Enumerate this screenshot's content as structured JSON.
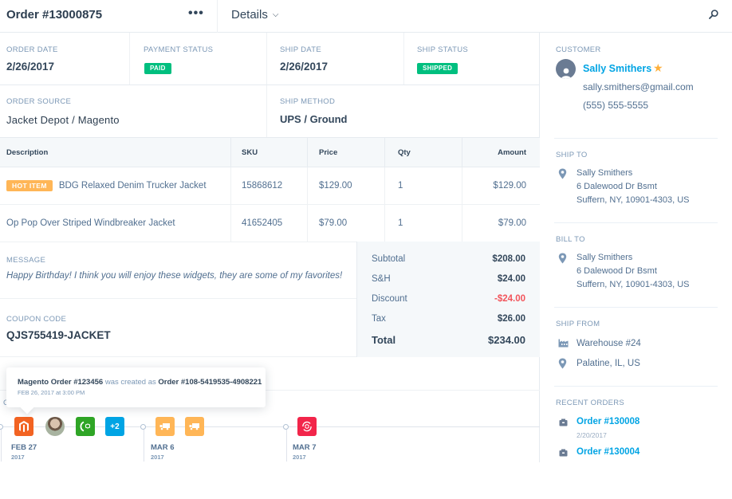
{
  "header": {
    "title": "Order #13000875",
    "more_icon": "more-horizontal-icon",
    "details_label": "Details",
    "search_icon": "search-icon"
  },
  "order_info": {
    "order_date": {
      "label": "ORDER DATE",
      "value": "2/26/2017"
    },
    "payment_status": {
      "label": "PAYMENT STATUS",
      "badge": "PAID",
      "color": "#00bf7f"
    },
    "ship_date": {
      "label": "SHIP DATE",
      "value": "2/26/2017"
    },
    "ship_status": {
      "label": "SHIP STATUS",
      "badge": "SHIPPED",
      "color": "#00bf7f"
    },
    "order_source": {
      "label": "ORDER SOURCE",
      "value": "Jacket Depot / Magento"
    },
    "ship_method": {
      "label": "SHIP METHOD",
      "value": "UPS / Ground"
    }
  },
  "line_items": {
    "columns": [
      "Description",
      "SKU",
      "Price",
      "Qty",
      "Amount"
    ],
    "rows": [
      {
        "tag": "HOT ITEM",
        "description": "BDG Relaxed Denim Trucker Jacket",
        "sku": "15868612",
        "price": "$129.00",
        "qty": "1",
        "amount": "$129.00"
      },
      {
        "tag": null,
        "description": "Op Pop Over Striped Windbreaker Jacket",
        "sku": "41652405",
        "price": "$79.00",
        "qty": "1",
        "amount": "$79.00"
      }
    ]
  },
  "message": {
    "label": "MESSAGE",
    "text": "Happy Birthday! I think you will enjoy these widgets, they are some of my favorites!"
  },
  "coupon": {
    "label": "COUPON CODE",
    "value": "QJS755419-JACKET"
  },
  "totals": {
    "subtotal": {
      "label": "Subtotal",
      "value": "$208.00"
    },
    "shipping": {
      "label": "S&H",
      "value": "$24.00"
    },
    "discount": {
      "label": "Discount",
      "value": "-$24.00",
      "color": "#f2545b"
    },
    "tax": {
      "label": "Tax",
      "value": "$26.00"
    },
    "total": {
      "label": "Total",
      "value": "$234.00"
    }
  },
  "activity": {
    "section_label_partial": "C",
    "tooltip": {
      "source": "Magento Order #123456",
      "verb": "was created as",
      "target": "Order #108-5419535-4908221",
      "timestamp": "FEB 26, 2017 at 3:00 PM"
    },
    "groups": [
      {
        "date": "FEB 27",
        "year": "2017",
        "events": [
          {
            "icon": "magento-icon",
            "color": "#f26322"
          },
          {
            "icon": "user-avatar",
            "color": null
          },
          {
            "icon": "package-sync-icon",
            "color": "#2fa526"
          },
          {
            "icon": "more-count",
            "label": "+2",
            "color": "#00a4e4"
          }
        ]
      },
      {
        "date": "MAR 6",
        "year": "2017",
        "events": [
          {
            "icon": "shipping-truck-icon",
            "color": "#ffb657"
          },
          {
            "icon": "shipping-truck-icon",
            "color": "#ffb657"
          }
        ]
      },
      {
        "date": "MAR 7",
        "year": "2017",
        "events": [
          {
            "icon": "package-return-icon",
            "color": "#f2254a"
          }
        ]
      }
    ]
  },
  "sidebar": {
    "customer": {
      "label": "CUSTOMER",
      "name": "Sally Smithers",
      "starred": true,
      "email": "sally.smithers@gmail.com",
      "phone": "(555) 555-5555"
    },
    "ship_to": {
      "label": "SHIP TO",
      "lines": [
        "Sally Smithers",
        "6 Dalewood Dr Bsmt",
        "Suffern, NY, 10901-4303, US"
      ]
    },
    "bill_to": {
      "label": "BILL TO",
      "lines": [
        "Sally Smithers",
        "6 Dalewood Dr Bsmt",
        "Suffern, NY, 10901-4303, US"
      ]
    },
    "ship_from": {
      "label": "SHIP FROM",
      "warehouse": "Warehouse #24",
      "location": "Palatine, IL, US"
    },
    "recent_orders": {
      "label": "RECENT ORDERS",
      "orders": [
        {
          "number": "Order #130008",
          "date": "2/20/2017"
        },
        {
          "number": "Order #130004",
          "date": ""
        }
      ]
    }
  },
  "colors": {
    "accent_link": "#00a4e4",
    "success": "#00bf7f",
    "warning": "#ffb657",
    "danger": "#f2545b",
    "text_primary": "#33475b",
    "text_label": "#7c98b6"
  }
}
